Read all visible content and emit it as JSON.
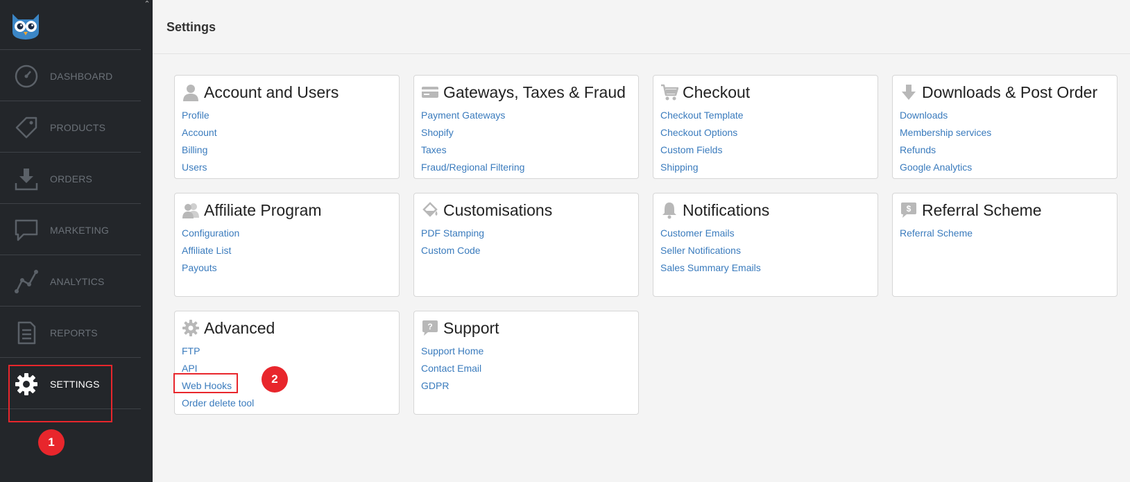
{
  "sidebar": {
    "items": [
      {
        "label": "DASHBOARD",
        "icon": "dashboard-gauge-icon",
        "active": false
      },
      {
        "label": "PRODUCTS",
        "icon": "tag-icon",
        "active": false
      },
      {
        "label": "ORDERS",
        "icon": "download-tray-icon",
        "active": false
      },
      {
        "label": "MARKETING",
        "icon": "speech-bubble-icon",
        "active": false
      },
      {
        "label": "ANALYTICS",
        "icon": "line-graph-icon",
        "active": false
      },
      {
        "label": "REPORTS",
        "icon": "document-icon",
        "active": false
      },
      {
        "label": "SETTINGS",
        "icon": "gear-icon",
        "active": true
      }
    ]
  },
  "header": {
    "title": "Settings"
  },
  "annotations": {
    "marker1": "1",
    "marker2": "2"
  },
  "colors": {
    "sidebar_bg": "#23262a",
    "link": "#3a7bbd",
    "highlight": "#e8262c"
  },
  "sections": [
    {
      "title": "Account and Users",
      "icon": "user-icon",
      "links": [
        "Profile",
        "Account",
        "Billing",
        "Users"
      ]
    },
    {
      "title": "Gateways, Taxes & Fraud",
      "icon": "credit-card-icon",
      "links": [
        "Payment Gateways",
        "Shopify",
        "Taxes",
        "Fraud/Regional Filtering"
      ]
    },
    {
      "title": "Checkout",
      "icon": "shopping-cart-icon",
      "links": [
        "Checkout Template",
        "Checkout Options",
        "Custom Fields",
        "Shipping"
      ]
    },
    {
      "title": "Downloads & Post Order",
      "icon": "download-arrow-icon",
      "links": [
        "Downloads",
        "Membership services",
        "Refunds",
        "Google Analytics"
      ]
    },
    {
      "title": "Affiliate Program",
      "icon": "users-icon",
      "links": [
        "Configuration",
        "Affiliate List",
        "Payouts"
      ]
    },
    {
      "title": "Customisations",
      "icon": "paint-bucket-icon",
      "links": [
        "PDF Stamping",
        "Custom Code"
      ]
    },
    {
      "title": "Notifications",
      "icon": "bell-icon",
      "links": [
        "Customer Emails",
        "Seller Notifications",
        "Sales Summary Emails"
      ]
    },
    {
      "title": "Referral Scheme",
      "icon": "dollar-bubble-icon",
      "links": [
        "Referral Scheme"
      ]
    },
    {
      "title": "Advanced",
      "icon": "cog-icon",
      "links": [
        "FTP",
        "API",
        "Web Hooks",
        "Order delete tool"
      ]
    },
    {
      "title": "Support",
      "icon": "question-icon",
      "links": [
        "Support Home",
        "Contact Email",
        "GDPR"
      ]
    }
  ]
}
